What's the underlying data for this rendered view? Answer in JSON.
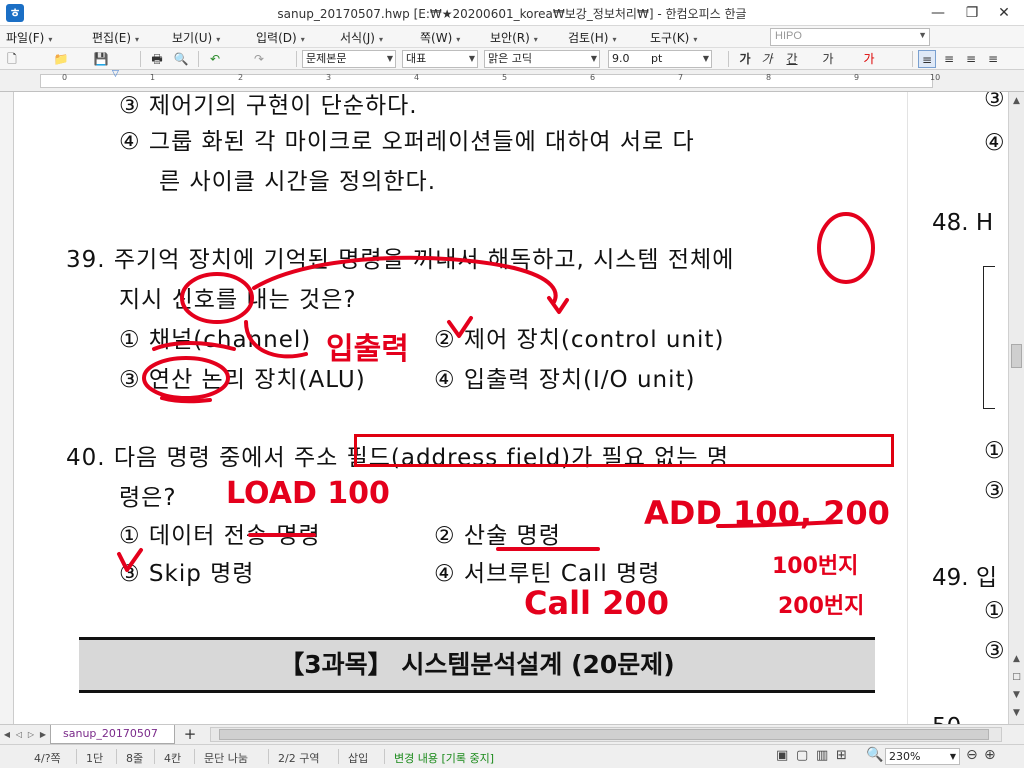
{
  "window": {
    "title": "sanup_20170507.hwp [E:₩★20200601_korea₩보강_정보처리₩] - 한컴오피스 한글",
    "icon": "hwp-app-icon",
    "controls": [
      "minimize",
      "restore",
      "close"
    ],
    "control_glyphs": {
      "minimize": "—",
      "restore": "❐",
      "close": "✕"
    },
    "app_icon_glyph": "ㅎ"
  },
  "menubar": {
    "items": [
      "파일(F)",
      "편집(E)",
      "보기(U)",
      "입력(D)",
      "서식(J)",
      "쪽(W)",
      "보안(R)",
      "검토(H)",
      "도구(K)"
    ],
    "search_value": "HIPO"
  },
  "toolbar": {
    "style_combo": "문제본문",
    "font_type_combo": "대표",
    "font_combo": "맑은 고딕",
    "size_combo": "9.0",
    "size_unit": "pt",
    "format_labels": {
      "bold": "가",
      "italic": "가",
      "underline": "간",
      "more": "가",
      "color": "가"
    },
    "align_icons": [
      "align-justify-icon",
      "align-left-icon",
      "align-center-icon",
      "align-right-icon"
    ]
  },
  "ruler": {
    "numbers": [
      "0",
      "1",
      "2",
      "3",
      "4",
      "5",
      "6",
      "7",
      "8",
      "9",
      "10"
    ]
  },
  "document": {
    "lines": [
      "③  제어기의 구현이 단순하다.",
      "④  그룹 화된 각 마이크로 오퍼레이션들에 대하여 서로 다",
      "른 사이클 시간을 정의한다.",
      "39.  주기억 장치에 기억된 명령을 꺼내서 해독하고, 시스템 전체에",
      "지시 신호를 내는 것은?",
      "①  채널(channel)",
      "②  제어 장치(control unit)",
      "③  연산 논리 장치(ALU)",
      "④  입출력 장치(I/O unit)",
      "40.  다음 명령 중에서 주소 필드(address field)가 필요 없는 명",
      "령은?",
      "①  데이터 전송 명령",
      "②  산술 명령",
      "③  Skip 명령",
      "④  서브루틴 Call 명령"
    ],
    "section_header": "【3과목】 시스템분석설계 (20문제)",
    "right_column": {
      "q48": "48.  H",
      "q49": "49.  입",
      "q50": "50."
    },
    "right_markers": [
      "③",
      "④",
      "①",
      "③",
      "①",
      "③"
    ],
    "handwriting": {
      "io": "입출력",
      "check": "✓",
      "load": "LOAD 100",
      "add": "ADD 100, 200",
      "ann1": "100번지",
      "ann2": "200번지",
      "call": "Call 200"
    }
  },
  "tabs": {
    "doc_tab": "sanup_20170507",
    "add": "+"
  },
  "statusbar": {
    "page": "4/?쪽",
    "column": "1단",
    "line": "8줄",
    "char": "4칸",
    "break": "문단 나눔",
    "section": "2/2 구역",
    "mode": "삽입",
    "track": "변경 내용 [기록 중지]",
    "zoom": "230%"
  },
  "colors": {
    "ink_red": "#e4001c",
    "tab_text": "#7a2a8a",
    "track_green": "#1a8a1a"
  }
}
